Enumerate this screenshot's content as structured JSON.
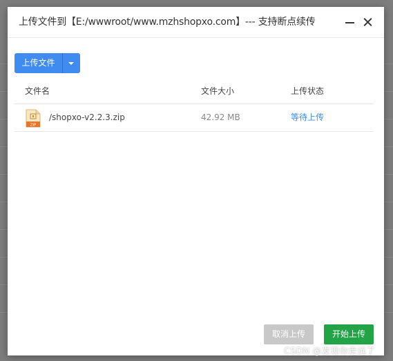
{
  "dialog": {
    "title": "上传文件到【E:/wwwroot/www.mzhshopxo.com】--- 支持断点续传"
  },
  "toolbar": {
    "upload_label": "上传文件"
  },
  "table": {
    "columns": [
      "文件名",
      "文件大小",
      "上传状态"
    ],
    "rows": [
      {
        "icon": "zip-file-icon",
        "name": "/shopxo-v2.2.3.zip",
        "size": "42.92 MB",
        "status": "等待上传"
      }
    ]
  },
  "footer": {
    "cancel_label": "取消上传",
    "start_label": "开始上传"
  },
  "watermark": "CSDN @发现你走远了",
  "colors": {
    "primary": "#3f8bf0",
    "success": "#22a346",
    "disabled": "#c8c8c8",
    "link": "#3a8ee6"
  }
}
